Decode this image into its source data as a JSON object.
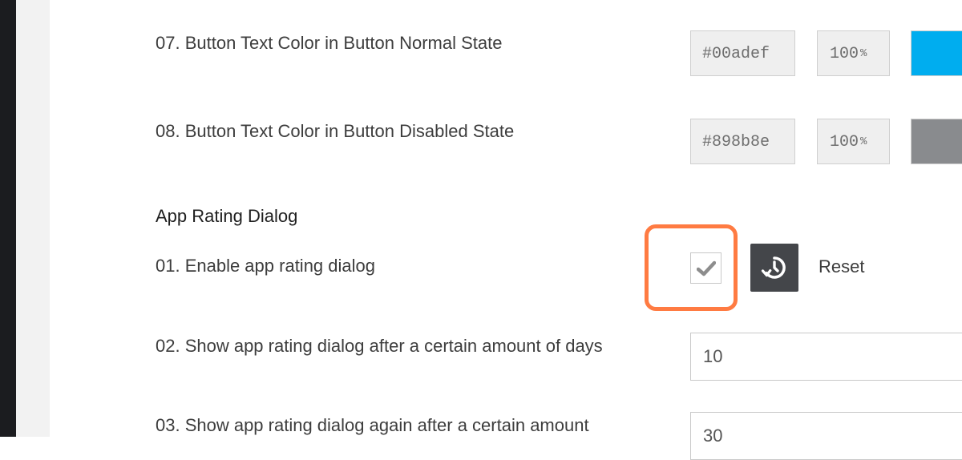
{
  "colors": {
    "normal_state": "#00adef",
    "disabled_state": "#898b8e",
    "highlight": "#ff7b42",
    "reset_button_bg": "#44464a"
  },
  "settings": {
    "button_text_normal": {
      "label": "07. Button Text Color in Button Normal State",
      "hex": "#00adef",
      "opacity": "100",
      "opacity_unit": "%"
    },
    "button_text_disabled": {
      "label": "08. Button Text Color in Button Disabled State",
      "hex": "#898b8e",
      "opacity": "100",
      "opacity_unit": "%"
    }
  },
  "app_rating": {
    "section_title": "App Rating Dialog",
    "enable": {
      "label": "01. Enable app rating dialog",
      "checked": true,
      "icon": "check-icon",
      "reset_icon": "reset-icon",
      "reset_label": "Reset"
    },
    "days": {
      "label": "02. Show app rating dialog after a certain amount of days",
      "value": "10"
    },
    "again": {
      "label": "03. Show app rating dialog again after a certain amount",
      "value": "30"
    }
  }
}
